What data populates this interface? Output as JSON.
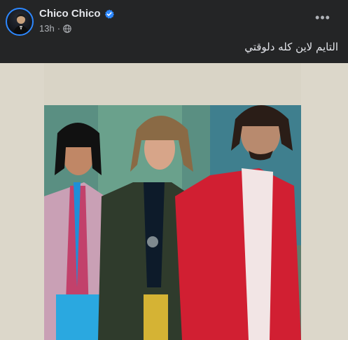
{
  "post": {
    "author": "Chico Chico",
    "verified": true,
    "time": "13h",
    "separator": "·",
    "audience_icon": "globe-icon",
    "more_icon": "more-options-icon",
    "caption": "التايم لاين كله دلوقتي",
    "media": {
      "type": "photo",
      "subjects": 3
    }
  },
  "colors": {
    "background": "#242526",
    "primary_text": "#e4e6eb",
    "secondary_text": "#b0b3b8",
    "verified_blue": "#2d88ff",
    "photo_background": "#dcd7ca"
  }
}
